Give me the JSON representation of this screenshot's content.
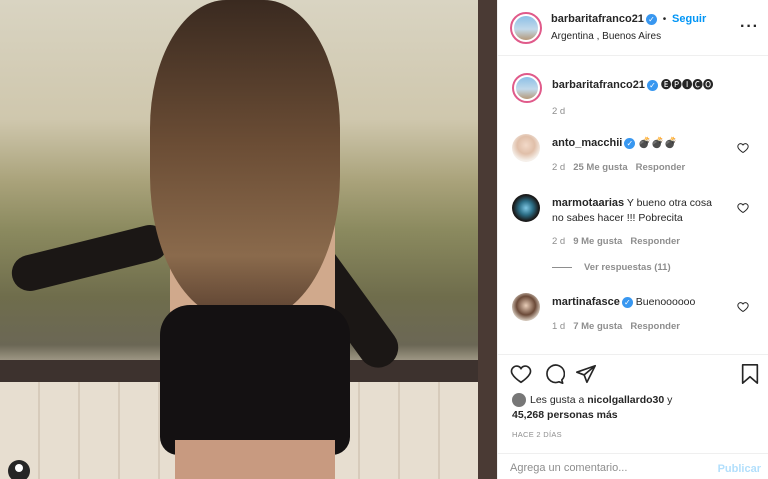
{
  "post": {
    "author": "barbaritafranco21",
    "follow_label": "Seguir",
    "location": "Argentina , Buenos Aires",
    "more_icon": "more-horizontal-icon"
  },
  "caption": {
    "author": "barbaritafranco21",
    "text": "🅔🅟🅘🅒🅞",
    "time": "2 d"
  },
  "comments": [
    {
      "user": "anto_macchii",
      "verified": true,
      "text": "💣💣💣",
      "time": "2 d",
      "likes": "25 Me gusta",
      "reply": "Responder"
    },
    {
      "user": "marmotaarias",
      "verified": false,
      "text": "Y bueno otra cosa no sabes hacer !!! Pobrecita",
      "time": "2 d",
      "likes": "9 Me gusta",
      "reply": "Responder"
    },
    {
      "user": "martinafasce",
      "verified": true,
      "text": "Buenoooooo",
      "time": "1 d",
      "likes": "7 Me gusta",
      "reply": "Responder"
    }
  ],
  "view_replies": "Ver respuestas (11)",
  "likes": {
    "prefix": "Les gusta a ",
    "user": "nicolgallardo30",
    "suffix": " y",
    "count": "45,268 personas más"
  },
  "timeago": "HACE 2 DÍAS",
  "add_comment": {
    "placeholder": "Agrega un comentario...",
    "publish_label": "Publicar"
  },
  "icons": {
    "like": "heart-icon",
    "comment": "comment-icon",
    "share": "share-icon",
    "save": "bookmark-icon"
  },
  "colors": {
    "accent": "#0095f6",
    "verified": "#3897f0",
    "muted": "#8e8e8e"
  }
}
